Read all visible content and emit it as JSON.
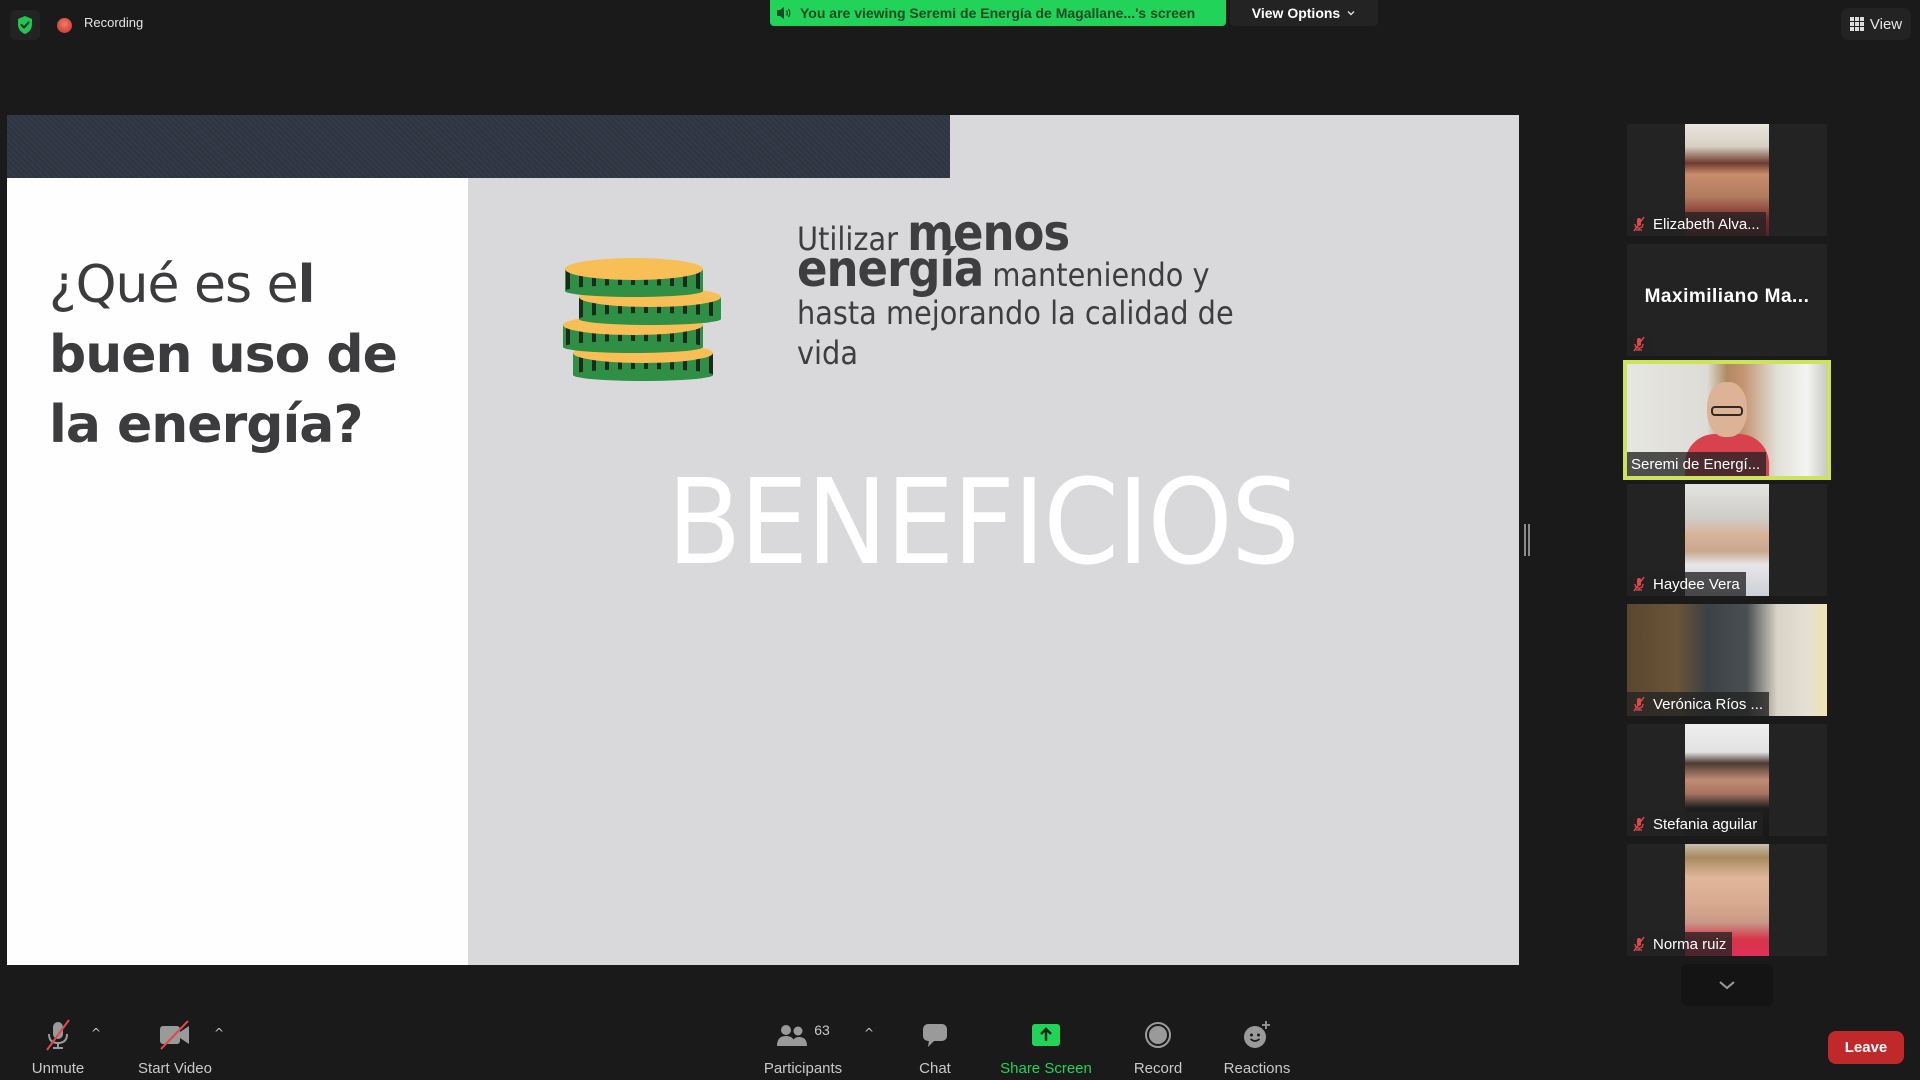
{
  "top_bar": {
    "security_icon": "shield-check-icon",
    "recording_label": "Recording",
    "viewing_banner": "You are viewing Seremi de Energía de Magallane...'s screen",
    "view_options_label": "View Options",
    "view_label": "View"
  },
  "slide": {
    "question_light": "¿Qué es e",
    "question_bold_l": "l",
    "question_line2": "buen uso de",
    "question_line3": "la energía?",
    "text_utilizar": "Utilizar ",
    "text_menos": "menos",
    "text_energia": "energía",
    "text_manteniendo": " manteniendo y",
    "text_line3": "hasta mejorando la calidad de",
    "text_line4": "vida",
    "heading": "BENEFICIOS",
    "coin_icon": "coin-stack-icon"
  },
  "participants": [
    {
      "name": "Elizabeth Alva...",
      "muted": true,
      "video": true
    },
    {
      "name": "Maximiliano  Ma...",
      "muted": true,
      "video": false
    },
    {
      "name": "Seremi de Energí...",
      "muted": false,
      "video": true,
      "active_speaker": true
    },
    {
      "name": "Haydee Vera",
      "muted": true,
      "video": true
    },
    {
      "name": "Verónica Ríos ...",
      "muted": true,
      "video": true
    },
    {
      "name": "Stefania aguilar",
      "muted": true,
      "video": true
    },
    {
      "name": "Norma ruiz",
      "muted": true,
      "video": true
    }
  ],
  "toolbar": {
    "unmute": "Unmute",
    "start_video": "Start Video",
    "participants": "Participants",
    "participants_count": "63",
    "chat": "Chat",
    "share_screen": "Share Screen",
    "record": "Record",
    "reactions": "Reactions",
    "leave": "Leave"
  },
  "colors": {
    "banner_green": "#22d35a",
    "share_green": "#22d35a",
    "leave_red": "#c0282a",
    "active_speaker_border": "#cbe45a",
    "muted_red": "#e0474c"
  }
}
